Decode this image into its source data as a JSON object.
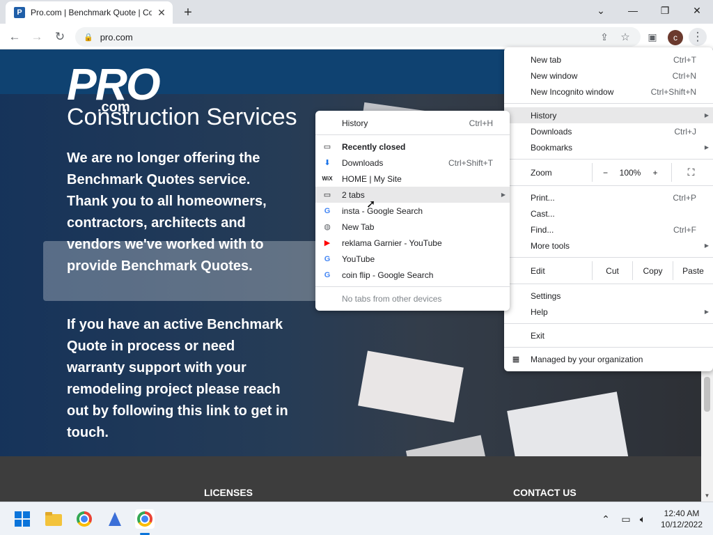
{
  "browser": {
    "tab_title": "Pro.com | Benchmark Quote | Co",
    "tab_favicon": "P",
    "url": "pro.com",
    "profile_initial": "c",
    "window_controls": {
      "minimize": "—",
      "restore": "❐",
      "close": "✕",
      "tab_search": "⌄"
    }
  },
  "page": {
    "logo": "PRO",
    "logo_sub": ".com",
    "tagline": "Construction Services",
    "paragraph1": "We are no longer offering the Benchmark Quotes service. Thank you to all homeowners, contractors, architects and vendors we've worked with to provide Benchmark Quotes.",
    "paragraph2": "If you have an active Benchmark Quote in process or need warranty support with your remodeling project please reach out by following this link to get in touch.",
    "footer_licenses": "LICENSES",
    "footer_contact": "CONTACT US"
  },
  "chrome_menu": {
    "new_tab": {
      "label": "New tab",
      "shortcut": "Ctrl+T"
    },
    "new_window": {
      "label": "New window",
      "shortcut": "Ctrl+N"
    },
    "new_incognito": {
      "label": "New Incognito window",
      "shortcut": "Ctrl+Shift+N"
    },
    "history": {
      "label": "History"
    },
    "downloads": {
      "label": "Downloads",
      "shortcut": "Ctrl+J"
    },
    "bookmarks": {
      "label": "Bookmarks"
    },
    "zoom": {
      "label": "Zoom",
      "minus": "−",
      "value": "100%",
      "plus": "+"
    },
    "print": {
      "label": "Print...",
      "shortcut": "Ctrl+P"
    },
    "cast": {
      "label": "Cast..."
    },
    "find": {
      "label": "Find...",
      "shortcut": "Ctrl+F"
    },
    "more_tools": {
      "label": "More tools"
    },
    "edit": {
      "label": "Edit",
      "cut": "Cut",
      "copy": "Copy",
      "paste": "Paste"
    },
    "settings": {
      "label": "Settings"
    },
    "help": {
      "label": "Help"
    },
    "exit": {
      "label": "Exit"
    },
    "managed": {
      "label": "Managed by your organization"
    }
  },
  "history_menu": {
    "history": {
      "label": "History",
      "shortcut": "Ctrl+H"
    },
    "recently_closed": "Recently closed",
    "items": [
      {
        "label": "Downloads",
        "shortcut": "Ctrl+Shift+T",
        "icon": "download-icon"
      },
      {
        "label": "HOME | My Site",
        "shortcut": "",
        "icon": "wix-icon"
      },
      {
        "label": "2 tabs",
        "shortcut": "",
        "icon": "window-icon"
      },
      {
        "label": "insta - Google Search",
        "shortcut": "",
        "icon": "google-icon"
      },
      {
        "label": "New Tab",
        "shortcut": "",
        "icon": "globe-icon"
      },
      {
        "label": "reklama Garnier - YouTube",
        "shortcut": "",
        "icon": "youtube-icon"
      },
      {
        "label": "YouTube",
        "shortcut": "",
        "icon": "google-icon"
      },
      {
        "label": "coin flip - Google Search",
        "shortcut": "",
        "icon": "google-icon"
      }
    ],
    "no_tabs": "No tabs from other devices"
  },
  "taskbar": {
    "time": "12:40 AM",
    "date": "10/12/2022"
  }
}
